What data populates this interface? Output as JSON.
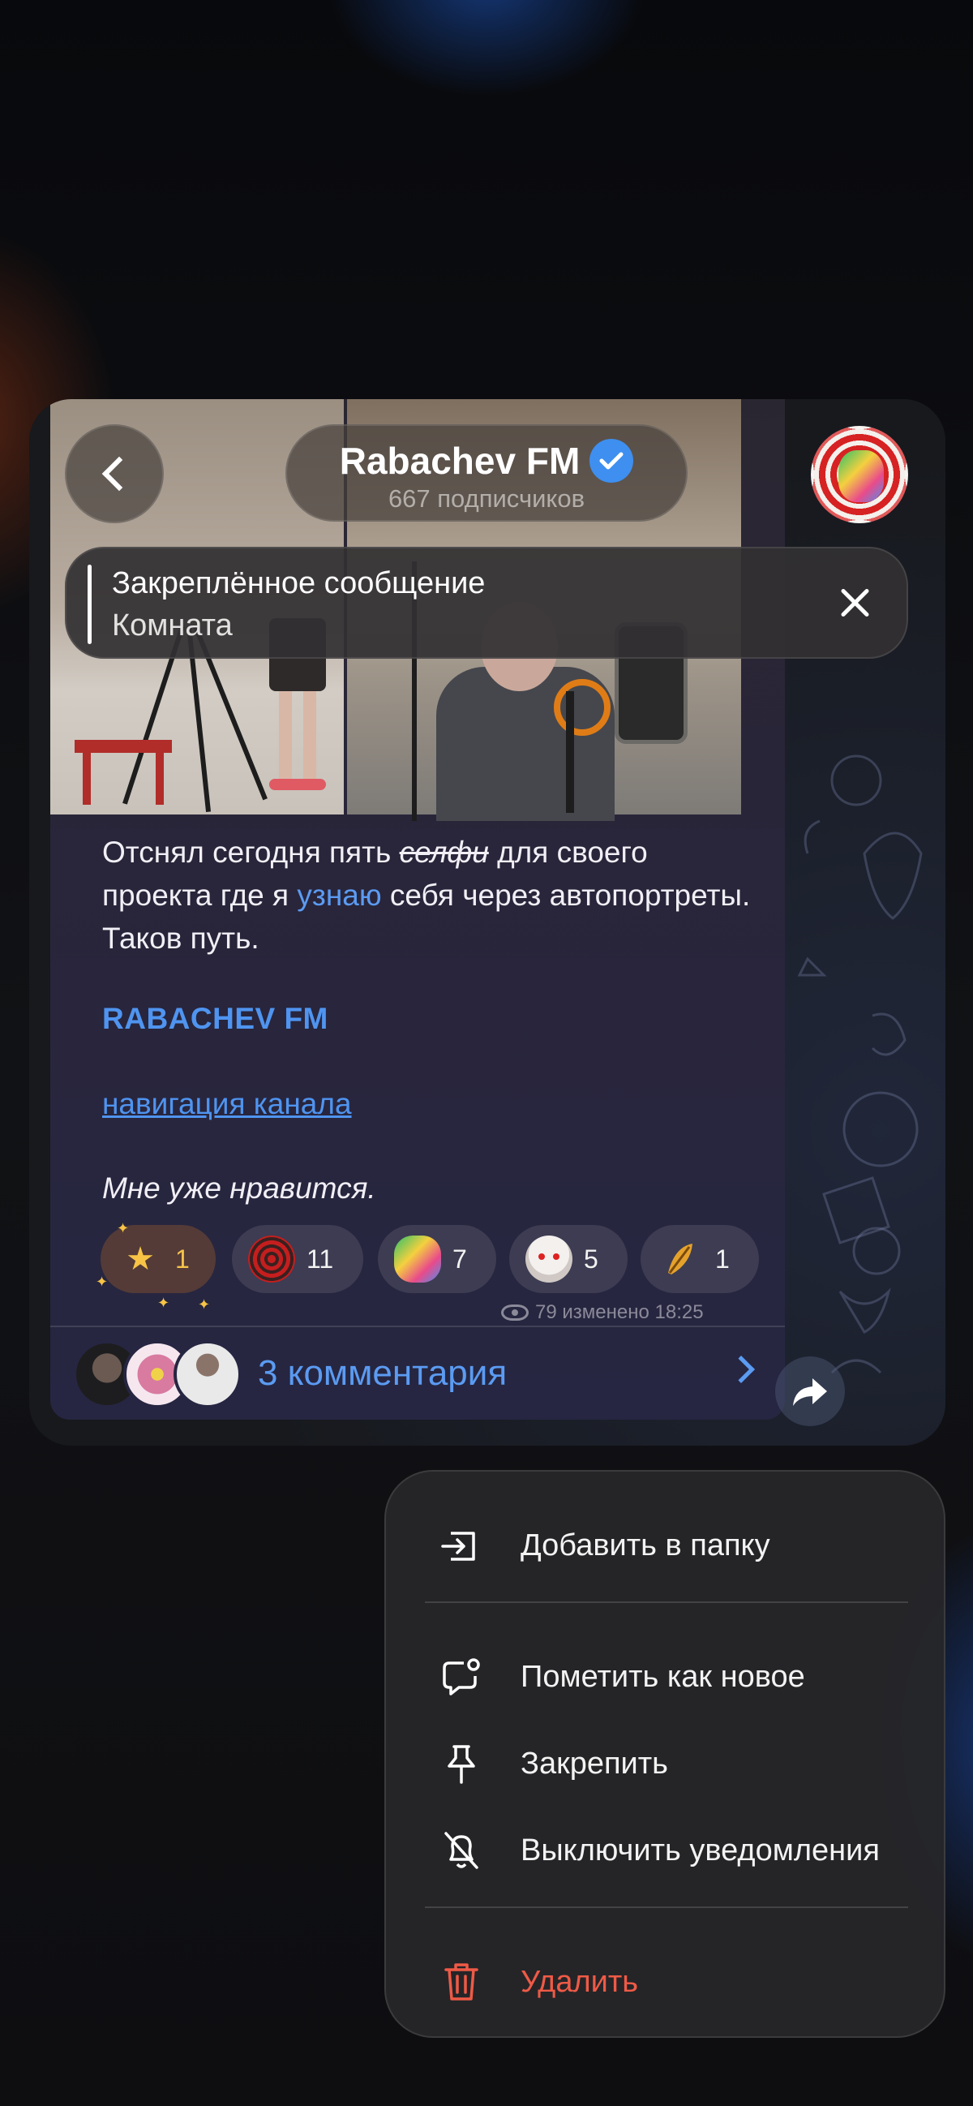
{
  "header": {
    "channel_name": "Rabachev FM",
    "subscribers": "667 подписчиков"
  },
  "pinned": {
    "title": "Закреплённое сообщение",
    "subtitle": "Комната"
  },
  "post": {
    "text_part1": "Отснял сегодня пять ",
    "text_strike": "селфи",
    "text_part2": " для своего проекта где я ",
    "text_link": "узнаю",
    "text_part3": " себя через автопортреты. Таков путь.",
    "channel_tag": "RABACHEV FM",
    "nav_link": "навигация канала",
    "italic_line": "Мне уже нравится.",
    "reactions": [
      {
        "emoji": "star",
        "count": "1"
      },
      {
        "emoji": "spiral",
        "count": "11"
      },
      {
        "emoji": "face-art",
        "count": "7"
      },
      {
        "emoji": "doll",
        "count": "5"
      },
      {
        "emoji": "leaf",
        "count": "1"
      }
    ],
    "meta": "79 изменено 18:25",
    "comments_label": "3 комментария"
  },
  "menu": {
    "items": [
      {
        "label": "Добавить в папку",
        "icon": "folder-add-icon"
      },
      {
        "label": "Пометить как новое",
        "icon": "mark-unread-icon"
      },
      {
        "label": "Закрепить",
        "icon": "pin-icon"
      },
      {
        "label": "Выключить уведомления",
        "icon": "mute-bell-icon"
      },
      {
        "label": "Удалить",
        "icon": "trash-icon"
      }
    ]
  },
  "colors": {
    "accent": "#5b9bf2",
    "danger": "#ef5a46",
    "verified": "#3e8ff0",
    "star_count": "#f5c34a"
  }
}
